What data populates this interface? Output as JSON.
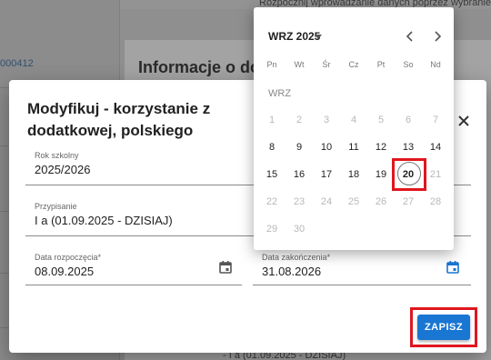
{
  "background": {
    "hint": "Rozpocznij wprowadzanie danych poprzez wybranie",
    "code": "000412",
    "section_title": "Informacje o do",
    "bottom_text": "- I a (01.09.2025 - DZISIAJ)"
  },
  "modal": {
    "title": "Modyfikuj - korzystanie z dodatkowej, polskiego",
    "school_year": {
      "label": "Rok szkolny",
      "value": "2025/2026"
    },
    "assignment": {
      "label": "Przypisanie",
      "value": "I a (01.09.2025 - DZISIAJ)"
    },
    "start_date": {
      "label": "Data rozpoczęcia*",
      "value": "08.09.2025",
      "icon": "calendar-icon"
    },
    "end_date": {
      "label": "Data zakończenia*",
      "value": "31.08.2026",
      "icon": "calendar-icon"
    },
    "save_label": "ZAPISZ"
  },
  "calendar": {
    "month_title": "WRZ 2025",
    "weekdays": [
      "Pn",
      "Wt",
      "Śr",
      "Cz",
      "Pt",
      "So",
      "Nd"
    ],
    "month_label": "WRZ",
    "weeks": [
      [
        "1",
        "2",
        "3",
        "4",
        "5",
        "6",
        "7"
      ],
      [
        "8",
        "9",
        "10",
        "11",
        "12",
        "13",
        "14"
      ],
      [
        "15",
        "16",
        "17",
        "18",
        "19",
        "20",
        "21"
      ],
      [
        "22",
        "23",
        "24",
        "25",
        "26",
        "27",
        "28"
      ],
      [
        "29",
        "30"
      ]
    ],
    "selected_day": "20"
  },
  "colors": {
    "accent": "#1976d2",
    "highlight": "#e0161e"
  }
}
